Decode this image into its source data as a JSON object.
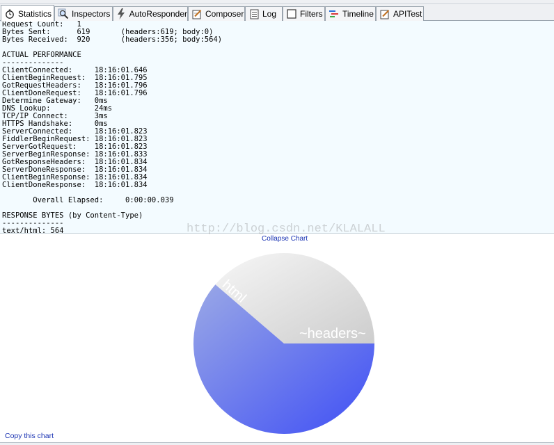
{
  "tabs": [
    {
      "label": "Statistics",
      "icon": "stopwatch-icon",
      "active": true
    },
    {
      "label": "Inspectors",
      "icon": "magnifier-icon",
      "active": false
    },
    {
      "label": "AutoResponder",
      "icon": "lightning-icon",
      "active": false
    },
    {
      "label": "Composer",
      "icon": "compose-icon",
      "active": false
    },
    {
      "label": "Log",
      "icon": "log-icon",
      "active": false
    },
    {
      "label": "Filters",
      "icon": "checkbox-icon",
      "active": false
    },
    {
      "label": "Timeline",
      "icon": "timeline-icon",
      "active": false
    },
    {
      "label": "APITest",
      "icon": "edit-icon",
      "active": false
    }
  ],
  "stats_lines": [
    "Request Count:   1",
    "Bytes Sent:      619       (headers:619; body:0)",
    "Bytes Received:  920       (headers:356; body:564)",
    "",
    "ACTUAL PERFORMANCE",
    "--------------",
    "ClientConnected:     18:16:01.646",
    "ClientBeginRequest:  18:16:01.795",
    "GotRequestHeaders:   18:16:01.796",
    "ClientDoneRequest:   18:16:01.796",
    "Determine Gateway:   0ms",
    "DNS Lookup:          24ms",
    "TCP/IP Connect:      3ms",
    "HTTPS Handshake:     0ms",
    "ServerConnected:     18:16:01.823",
    "FiddlerBeginRequest: 18:16:01.823",
    "ServerGotRequest:    18:16:01.823",
    "ServerBeginResponse: 18:16:01.833",
    "GotResponseHeaders:  18:16:01.834",
    "ServerDoneResponse:  18:16:01.834",
    "ClientBeginResponse: 18:16:01.834",
    "ClientDoneResponse:  18:16:01.834",
    "",
    "       Overall Elapsed:     0:00:00.039",
    "",
    "RESPONSE BYTES (by Content-Type)",
    "--------------",
    "text/html: 564"
  ],
  "watermark": "http://blog.csdn.net/KLALALL",
  "collapse_label": "Collapse Chart",
  "copy_label": "Copy this chart",
  "chart_data": {
    "type": "pie",
    "slices": [
      {
        "label": "~headers~",
        "value": 356,
        "color_from": "#f6f6f6",
        "color_to": "#cdcdcd"
      },
      {
        "label": "html",
        "value": 564,
        "color_from": "#9aa8e6",
        "color_to": "#3f4ff5"
      }
    ]
  }
}
